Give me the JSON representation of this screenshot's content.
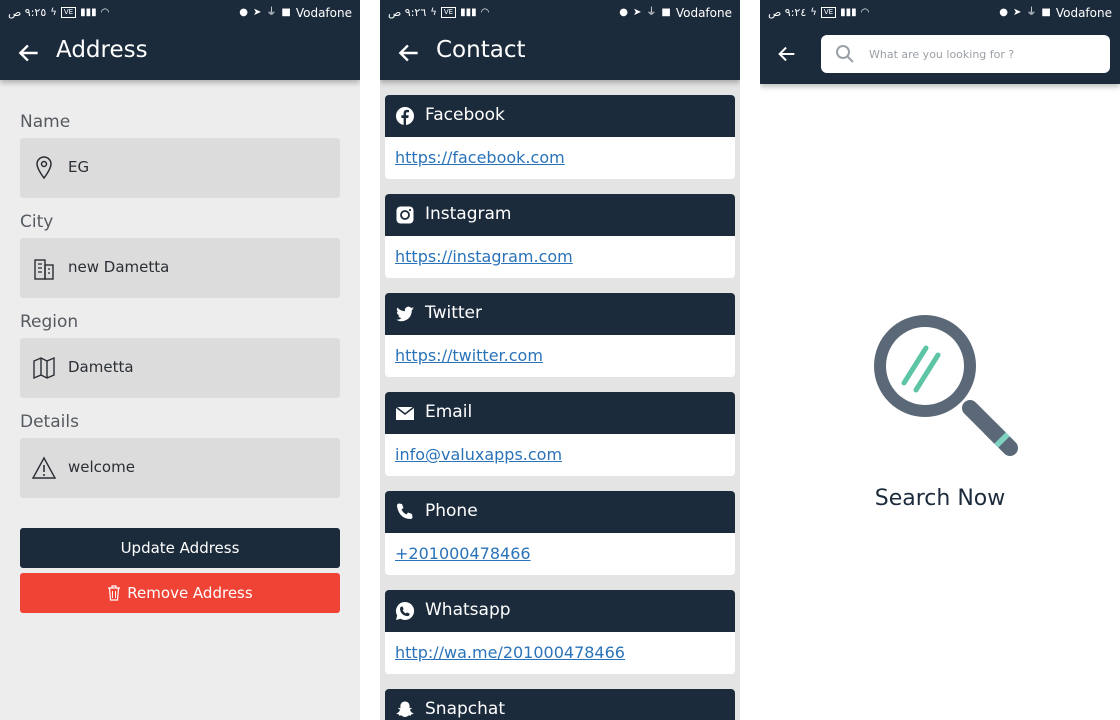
{
  "status_bar": {
    "time": "٩:٢٥ ص",
    "time_contact": "٩:٢٦ ص",
    "time_search": "٩:٢٤ ص",
    "network_badge": "VE",
    "signal": "4G",
    "carrier": "Vodafone"
  },
  "address_screen": {
    "title": "Address",
    "fields": [
      {
        "label": "Name",
        "value": "EG",
        "icon": "location-pin-icon"
      },
      {
        "label": "City",
        "value": "new Dametta",
        "icon": "building-icon"
      },
      {
        "label": "Region",
        "value": "Dametta",
        "icon": "map-icon"
      },
      {
        "label": "Details",
        "value": "welcome",
        "icon": "warning-icon"
      }
    ],
    "update_button": "Update Address",
    "remove_button": "Remove Address"
  },
  "contact_screen": {
    "title": "Contact",
    "items": [
      {
        "label": "Facebook",
        "link": "https://facebook.com",
        "icon": "facebook-icon"
      },
      {
        "label": "Instagram",
        "link": "https://instagram.com",
        "icon": "instagram-icon"
      },
      {
        "label": "Twitter",
        "link": "https://twitter.com",
        "icon": "twitter-icon"
      },
      {
        "label": "Email",
        "link": "info@valuxapps.com",
        "icon": "email-icon"
      },
      {
        "label": "Phone",
        "link": "+201000478466",
        "icon": "phone-icon"
      },
      {
        "label": "Whatsapp",
        "link": "http://wa.me/201000478466",
        "icon": "whatsapp-icon"
      },
      {
        "label": "Snapchat",
        "icon": "snapchat-icon"
      }
    ]
  },
  "search_screen": {
    "placeholder": "What are you looking for ?",
    "empty_text": "Search Now"
  },
  "colors": {
    "primary": "#1c2b3c",
    "danger": "#ef4335",
    "link": "#2a73b9",
    "accent": "#5ec4a6"
  }
}
